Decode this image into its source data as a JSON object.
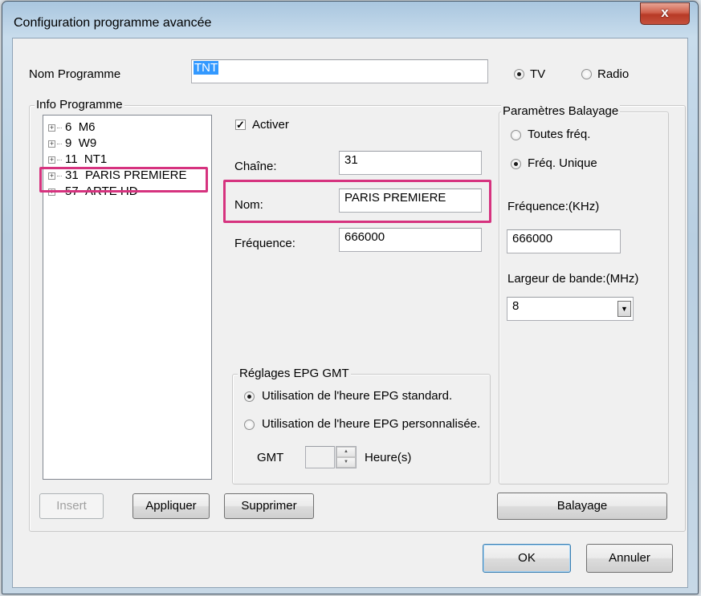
{
  "window": {
    "title": "Configuration programme avancée",
    "close_label": "x"
  },
  "nom_programme": {
    "label": "Nom Programme",
    "value": "TNT"
  },
  "type": {
    "tv_label": "TV",
    "radio_label": "Radio",
    "selected": "TV"
  },
  "info_programme": {
    "title": "Info Programme",
    "channels": [
      {
        "number": "6",
        "name": "M6"
      },
      {
        "number": "9",
        "name": "W9"
      },
      {
        "number": "11",
        "name": "NT1"
      },
      {
        "number": "31",
        "name": "PARIS PREMIERE"
      },
      {
        "number": "57",
        "name": "ARTE HD"
      }
    ],
    "selected_channel": "31"
  },
  "details": {
    "activer_label": "Activer",
    "activer_checked": true,
    "chaine_label": "Chaîne:",
    "chaine_value": "31",
    "nom_label": "Nom:",
    "nom_value": "PARIS PREMIERE",
    "frequence_label": "Fréquence:",
    "frequence_value": "666000"
  },
  "epg": {
    "title": "Réglages EPG GMT",
    "standard_label": "Utilisation de l'heure EPG standard.",
    "custom_label": "Utilisation de l'heure EPG personnalisée.",
    "selected": "standard",
    "gmt_label": "GMT",
    "gmt_value": "",
    "heures_label": "Heure(s)"
  },
  "balayage": {
    "title": "Paramètres Balayage",
    "toutes_label": "Toutes fréq.",
    "unique_label": "Fréq. Unique",
    "selected": "unique",
    "frequence_label": "Fréquence:(KHz)",
    "frequence_value": "666000",
    "largeur_label": "Largeur de bande:(MHz)",
    "largeur_value": "8"
  },
  "buttons": {
    "insert": "Insert",
    "appliquer": "Appliquer",
    "supprimer": "Supprimer",
    "balayage": "Balayage",
    "ok": "OK",
    "annuler": "Annuler"
  },
  "colors": {
    "highlight": "#d6337f",
    "selection": "#3399ff"
  }
}
